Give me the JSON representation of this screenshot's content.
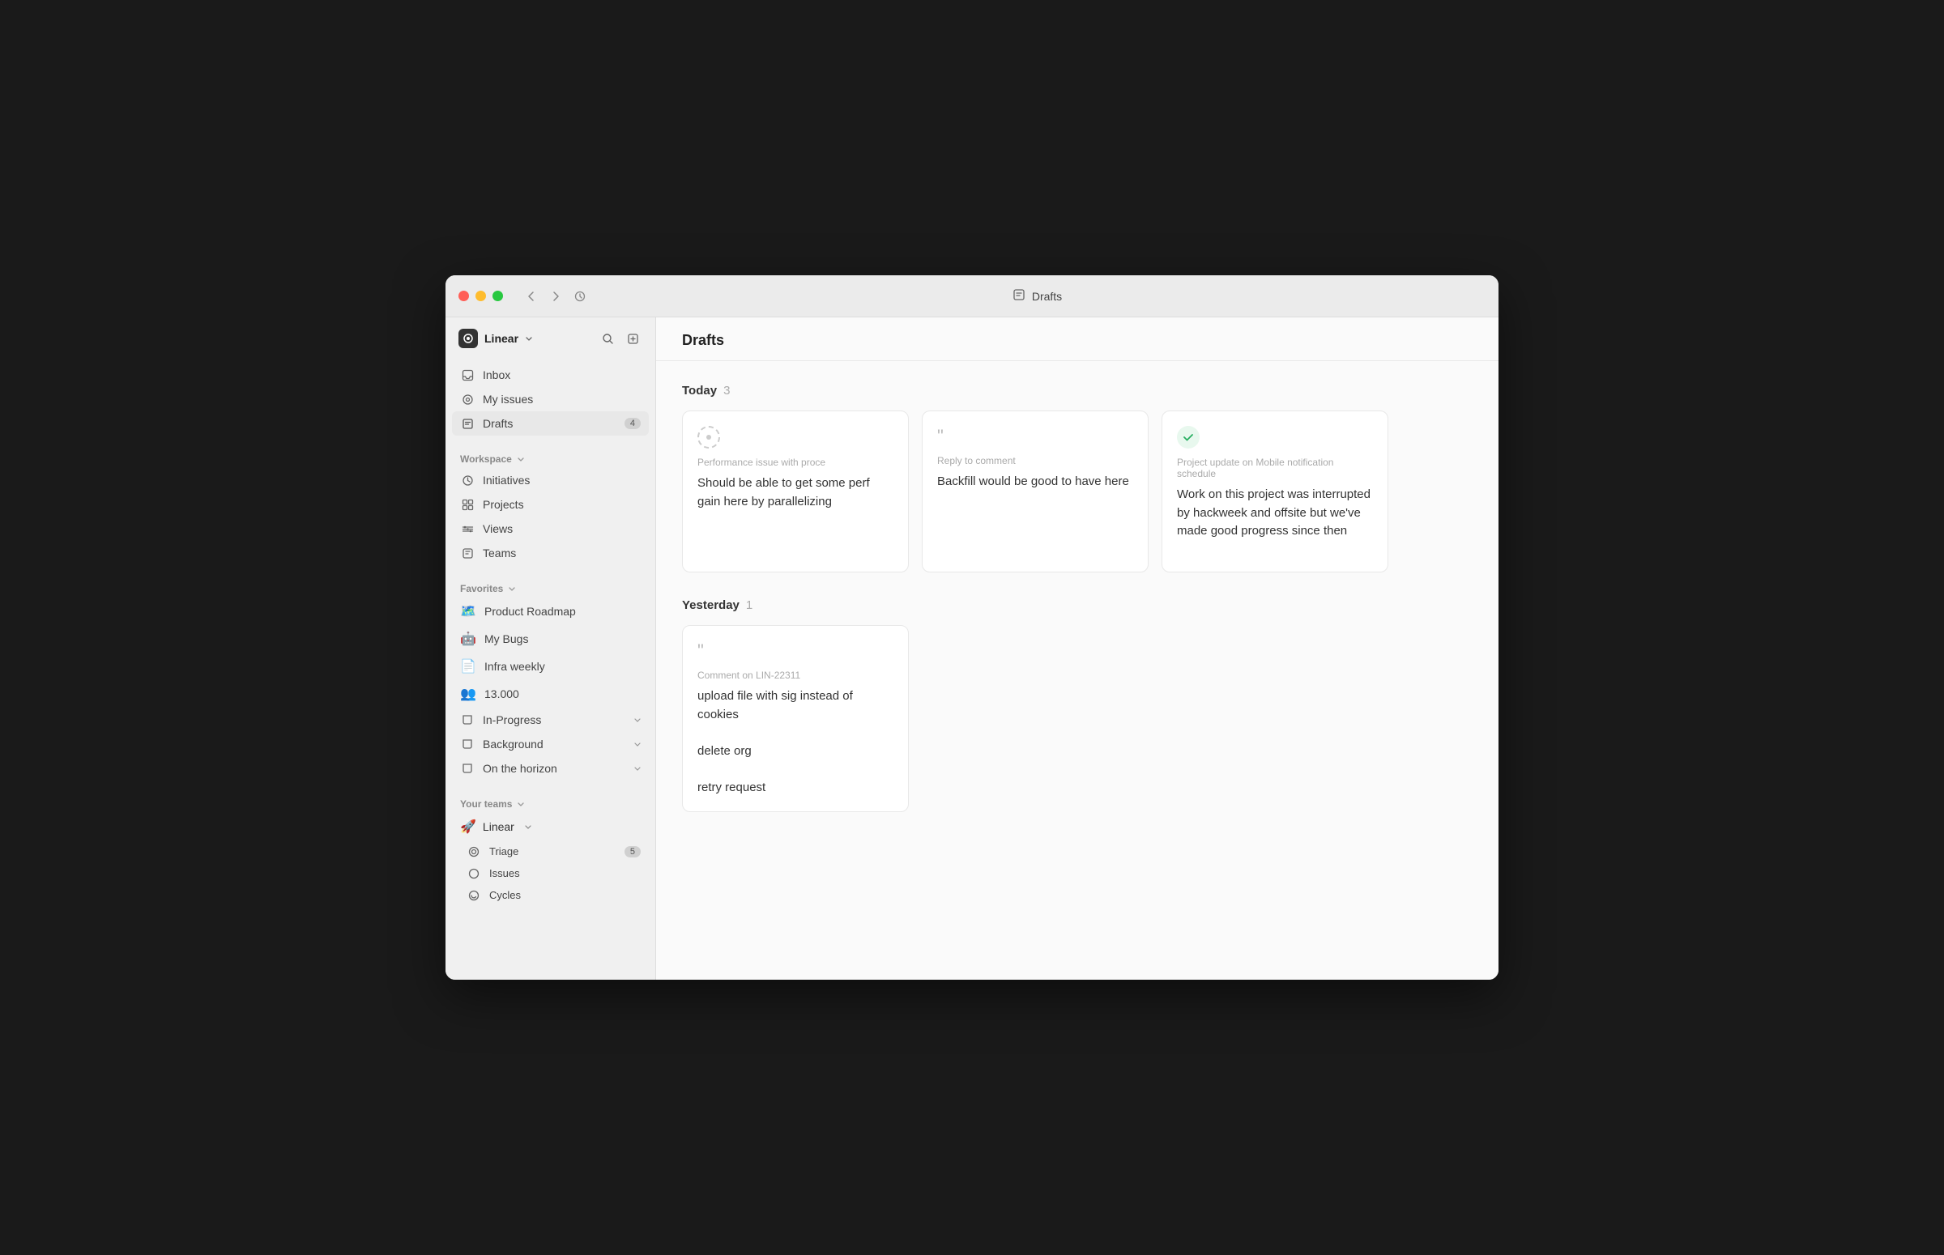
{
  "window": {
    "titlebar": {
      "title": "Drafts",
      "back_label": "←",
      "forward_label": "→",
      "history_label": "⊙"
    }
  },
  "sidebar": {
    "workspace_name": "Linear",
    "search_placeholder": "Search",
    "nav_items": [
      {
        "id": "inbox",
        "label": "Inbox",
        "icon": "inbox"
      },
      {
        "id": "my-issues",
        "label": "My issues",
        "icon": "target"
      },
      {
        "id": "drafts",
        "label": "Drafts",
        "icon": "drafts",
        "badge": "4",
        "active": true
      }
    ],
    "workspace_section": {
      "label": "Workspace",
      "items": [
        {
          "id": "initiatives",
          "label": "Initiatives",
          "icon": "initiatives"
        },
        {
          "id": "projects",
          "label": "Projects",
          "icon": "projects"
        },
        {
          "id": "views",
          "label": "Views",
          "icon": "views"
        },
        {
          "id": "teams",
          "label": "Teams",
          "icon": "teams"
        }
      ]
    },
    "favorites_section": {
      "label": "Favorites",
      "items": [
        {
          "id": "product-roadmap",
          "label": "Product Roadmap",
          "icon": "🗺️"
        },
        {
          "id": "my-bugs",
          "label": "My Bugs",
          "icon": "🤖"
        },
        {
          "id": "infra-weekly",
          "label": "Infra weekly",
          "icon": "📄"
        },
        {
          "id": "13000",
          "label": "13.000",
          "icon": "👥"
        },
        {
          "id": "in-progress",
          "label": "In-Progress",
          "icon": "folder",
          "arrow": true
        },
        {
          "id": "background",
          "label": "Background",
          "icon": "folder",
          "arrow": true
        },
        {
          "id": "on-the-horizon",
          "label": "On the horizon",
          "icon": "folder",
          "arrow": true
        }
      ]
    },
    "your_teams_section": {
      "label": "Your teams",
      "teams": [
        {
          "id": "linear",
          "label": "Linear",
          "icon": "🚀",
          "sub_items": [
            {
              "id": "triage",
              "label": "Triage",
              "badge": "5"
            },
            {
              "id": "issues",
              "label": "Issues",
              "badge": ""
            },
            {
              "id": "cycles",
              "label": "Cycles",
              "badge": ""
            }
          ]
        }
      ]
    }
  },
  "main": {
    "title": "Drafts",
    "sections": [
      {
        "id": "today",
        "label": "Today",
        "count": "3",
        "cards": [
          {
            "id": "card-1",
            "icon_type": "spinner",
            "subtitle": "Performance issue with proce",
            "body": "Should be able to get some perf gain here by parallelizing"
          },
          {
            "id": "card-2",
            "icon_type": "quote",
            "subtitle": "Reply to comment",
            "body": "Backfill would be good to have here"
          },
          {
            "id": "card-3",
            "icon_type": "status-green",
            "subtitle": "Project update on Mobile notification schedule",
            "body": "Work on this project was interrupted by hackweek and offsite but we've made good progress since then"
          }
        ]
      },
      {
        "id": "yesterday",
        "label": "Yesterday",
        "count": "1",
        "cards": [
          {
            "id": "card-4",
            "icon_type": "quote",
            "subtitle": "Comment on LIN-22311",
            "body": "upload file with sig instead of cookies\n\ndelete org\n\nretry request"
          }
        ]
      }
    ]
  }
}
